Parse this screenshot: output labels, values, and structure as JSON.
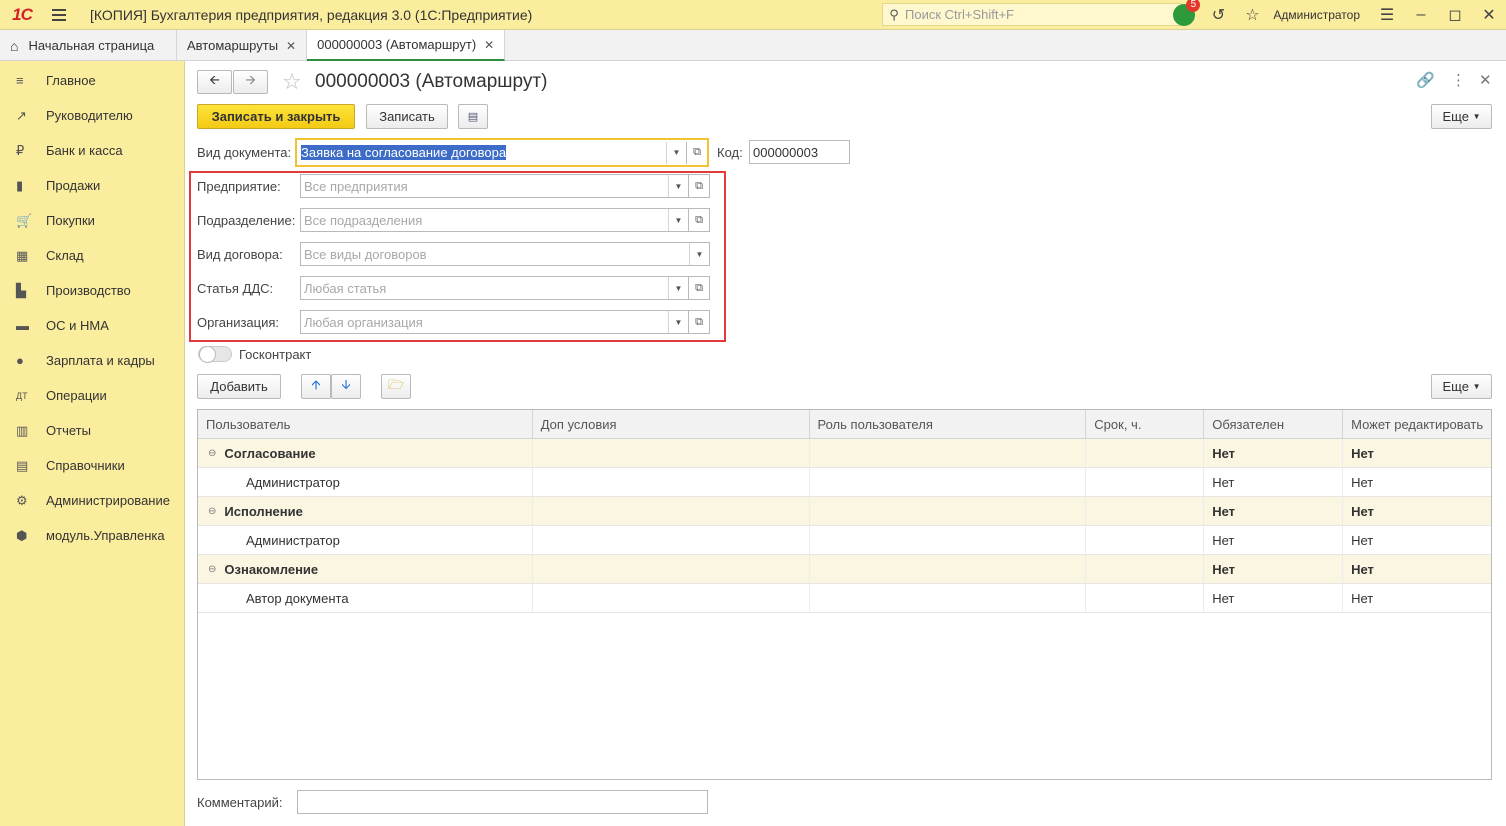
{
  "app": {
    "logo": "1С",
    "title": "[КОПИЯ] Бухгалтерия предприятия, редакция 3.0  (1С:Предприятие)",
    "search_placeholder": "Поиск Ctrl+Shift+F",
    "notifications": "5",
    "user": "Администратор"
  },
  "tabs": [
    {
      "label": "Начальная страница"
    },
    {
      "label": "Автомаршруты"
    },
    {
      "label": "000000003 (Автомаршрут)"
    }
  ],
  "sidebar": {
    "items": [
      {
        "label": "Главное",
        "icon": "≡"
      },
      {
        "label": "Руководителю",
        "icon": "↗"
      },
      {
        "label": "Банк и касса",
        "icon": "₽"
      },
      {
        "label": "Продажи",
        "icon": "▮"
      },
      {
        "label": "Покупки",
        "icon": "🛒"
      },
      {
        "label": "Склад",
        "icon": "▦"
      },
      {
        "label": "Производство",
        "icon": "▙"
      },
      {
        "label": "ОС и НМА",
        "icon": "▬"
      },
      {
        "label": "Зарплата и кадры",
        "icon": "●"
      },
      {
        "label": "Операции",
        "icon": "ДТ"
      },
      {
        "label": "Отчеты",
        "icon": "▥"
      },
      {
        "label": "Справочники",
        "icon": "▤"
      },
      {
        "label": "Администрирование",
        "icon": "⚙"
      },
      {
        "label": "модуль.Управленка",
        "icon": "⬢"
      }
    ]
  },
  "form": {
    "title": "000000003 (Автомаршрут)",
    "save_close": "Записать и закрыть",
    "save": "Записать",
    "more": "Еще",
    "doc_type_label": "Вид документа:",
    "doc_type_value": "Заявка на согласование договора",
    "code_label": "Код:",
    "code_value": "000000003",
    "fields": [
      {
        "label": "Предприятие:",
        "placeholder": "Все предприятия"
      },
      {
        "label": "Подразделение:",
        "placeholder": "Все подразделения"
      },
      {
        "label": "Вид договора:",
        "placeholder": "Все виды договоров"
      },
      {
        "label": "Статья ДДС:",
        "placeholder": "Любая статья"
      },
      {
        "label": "Организация:",
        "placeholder": "Любая организация"
      }
    ],
    "gov_contract_label": "Госконтракт",
    "add": "Добавить",
    "more2": "Еще",
    "comment_label": "Комментарий:",
    "comment_value": ""
  },
  "table": {
    "columns": [
      "Пользователь",
      "Доп условия",
      "Роль пользователя",
      "Срок, ч.",
      "Обязателен",
      "Может редактировать"
    ],
    "rows": [
      {
        "group": true,
        "user": "Согласование",
        "req": "Нет",
        "edit": "Нет"
      },
      {
        "group": false,
        "user": "Администратор",
        "req": "Нет",
        "edit": "Нет"
      },
      {
        "group": true,
        "user": "Исполнение",
        "req": "Нет",
        "edit": "Нет"
      },
      {
        "group": false,
        "user": "Администратор",
        "req": "Нет",
        "edit": "Нет"
      },
      {
        "group": true,
        "user": "Ознакомление",
        "req": "Нет",
        "edit": "Нет"
      },
      {
        "group": false,
        "user": "Автор документа",
        "req": "Нет",
        "edit": "Нет"
      }
    ]
  },
  "colors": {
    "accent_yellow": "#fbed9e",
    "highlight_red": "#e03a3a",
    "selection": "#3c6cc7"
  }
}
